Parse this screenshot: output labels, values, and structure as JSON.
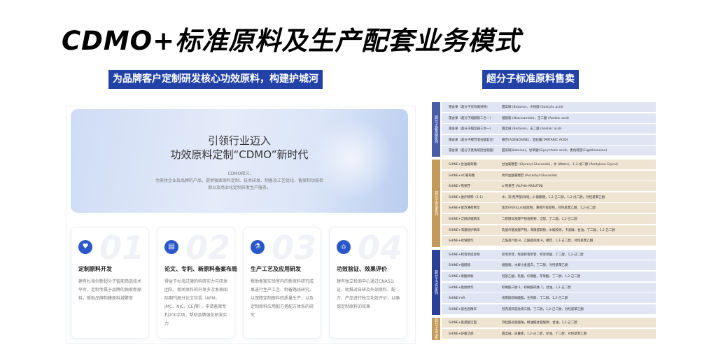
{
  "title": "CDMO+标准原料及生产配套业务模式",
  "left_tag": "为品牌客户定制研发核心功效原料，构建护城河",
  "right_tag": "超分子标准原料售卖",
  "hero": {
    "title_line1": "引领行业迈入",
    "title_line2": "功效原料定制“CDMO”新时代",
    "subtitle": "CDMO释义:",
    "description": "为美妆企业及品牌的产品、提供独家原料定制、技术研发、制备及工艺优化、备案和功效检测以及商业化定制研发生产服务。"
  },
  "cards": [
    {
      "num": "01",
      "icon": "heart-hand-icon",
      "glyph": "♥",
      "title": "定制原料开发",
      "desc": "建有杉海创新超分子智能筛选技术平台，定制专属于品牌的独家新原料，帮助品牌构建原料城壁垒"
    },
    {
      "num": "02",
      "icon": "document-icon",
      "glyph": "▤",
      "title": "论文、专利、新原料备案布局",
      "desc": "得益于杉海过硬的科研实力与研发团队，相关原料的开发多次发表国际期刊高分论文包括（AFM、JMC、NJC、CEJ等），申请备案专利200余项，帮助品牌强化研发实力"
    },
    {
      "num": "03",
      "icon": "flask-icon",
      "glyph": "⚗",
      "title": "生产工艺及应用研发",
      "desc": "帮助备案实验室内的新原料研究成果进行生产工艺、制备路线研究，以保障定制原料的质量生产，以及定制原料应用配方搭配方体系的研究"
    },
    {
      "num": "04",
      "icon": "house-icon",
      "glyph": "⌂",
      "title": "功效验证、效果评价",
      "desc": "建有独立检测中心通过CNAS认证，助推对自研及外部原料、配方、产品进行独立功效评价，以确保定制原料的效果"
    }
  ],
  "colors": {
    "tag_bg": "#2242a8",
    "sec1": "#4a5ca8",
    "sec2": "#c49a5a",
    "sec3": "#2a3f98",
    "sec4": "#c49a5a",
    "row_blue": "#dfe5f3",
    "row_tan": "#efe3d1"
  },
  "table_sections": [
    {
      "label": "超分子甜菜碱系列",
      "color": "#4a5ca8",
      "row_color": "#dfe5f3",
      "rows": [
        {
          "name": "雷舍果（超分子双效雅诗顿）",
          "desc": "甜菜碱 (Betaine)，水杨酸 (Salicylic acid)"
        },
        {
          "name": "雷舍果（超分子烟酰胺二合一）",
          "desc": "烟酰胺 (Niacinamide)，壬二酸 (Azelaic acid)"
        },
        {
          "name": "雷舍果（超分子甜菜碱三合一）",
          "desc": "甜菜碱 (Betaine)，壬二酸 (Azelaic acid)"
        },
        {
          "name": "雷舍果（超分子腺苷酒石酸复合）",
          "desc": "腺苷(ADENOSINE)，酒石酸(TARTARIC ACID)"
        },
        {
          "name": "雷舍果（超分子麦角硫因甘氨酸）",
          "desc": "甜菜碱(Betaine)，甘草酸(Glycyrrhizic acid)，麦角硫因(Ergothioneine)"
        }
      ]
    },
    {
      "label": "超分子保湿系列",
      "color": "#c49a5a",
      "row_color": "#efe3d1",
      "rows": [
        {
          "name": "SHINE+甘油葡萄糖",
          "desc": "甘油葡糖苷 (Glyceryl Glucoside)，水 (Water)，1,2-戊二醇 (Pentylene Glycol)"
        },
        {
          "name": "SHINE+VC葡萄糖",
          "desc": "抗坏血酸葡糖苷 (Ascorbyl Glucoside)"
        },
        {
          "name": "SHINE+熊果苷",
          "desc": "α-熊果苷 (ALPHA-ARBUTIN)"
        },
        {
          "name": "SHINE+维护精粹（1:1）",
          "desc": "水，双(羟甲基)咪唑，β-葡聚糖，1,2-己二醇，1,2-戊二醇，对羟基苯乙酮"
        },
        {
          "name": "SHINE+紫苏薄荷精华",
          "desc": "紫苏(PERILLA)提取物，薄荷叶提取物，对羟基苯乙酮，1,2-己二醇"
        },
        {
          "name": "SHINE+泛醇舒缓精华",
          "desc": "二裂酵母发酵产物溶胞物，泛醇，丁二醇，1,2-己二醇"
        },
        {
          "name": "SHINE+海藻修护精华",
          "desc": "乳酸杆菌发酵产物，海藻提取物，水解胶原，卡波姆，甘油，丁二醇，1,2-己二醇"
        },
        {
          "name": "SHINE+抗皱精华",
          "desc": "乙酰基六肽-8，乙酰基四肽-9，腺苷，1,2-己二醇，对羟基苯乙酮"
        }
      ]
    },
    {
      "label": "超分子活性系列",
      "color": "#2a3f98",
      "row_color": "#dfe5f3",
      "rows": [
        {
          "name": "SHINE+积雪草提取物",
          "desc": "积雪草苷，羟基积雪草苷，积雪草酸，丁二醇，1,2-己二醇"
        },
        {
          "name": "SHINE+烟酰胺",
          "desc": "烟酰胺，水解小麦蛋白，丁二醇，对羟基苯乙酮"
        },
        {
          "name": "SHINE+果酸焕肤",
          "desc": "羟基乙酸，乳酸，柠檬酸，苹果酸，丁二醇，1,2-己二醇"
        },
        {
          "name": "SHINE+胜肽精华",
          "desc": "棕榈酰三肽-1，棕榈酰四肽-7，甘油，1,2-己二醇"
        },
        {
          "name": "SHINE+VA",
          "desc": "视黄醇棕榈酸酯，生育酚，丁二醇，1,2-己二醇"
        },
        {
          "name": "SHINE+玻色因精华",
          "desc": "羟丙基四氢吡喃三醇，丁二醇，1,2-己二醇，对羟基苯乙酮"
        }
      ]
    },
    {
      "label": "超分子清洁系列",
      "color": "#c49a5a",
      "row_color": "#efe3d1",
      "rows": [
        {
          "name": "SHINE+氨基酸洁面",
          "desc": "月桂酰谷氨酸钠，椰油酰甘氨酸钾，甘油，1,2-己二醇"
        },
        {
          "name": "SHINE+舒缓洁颜",
          "desc": "甜菜碱，尿囊素，1,2-己二醇，甘油，丁二醇，对羟基苯乙酮"
        }
      ]
    }
  ]
}
